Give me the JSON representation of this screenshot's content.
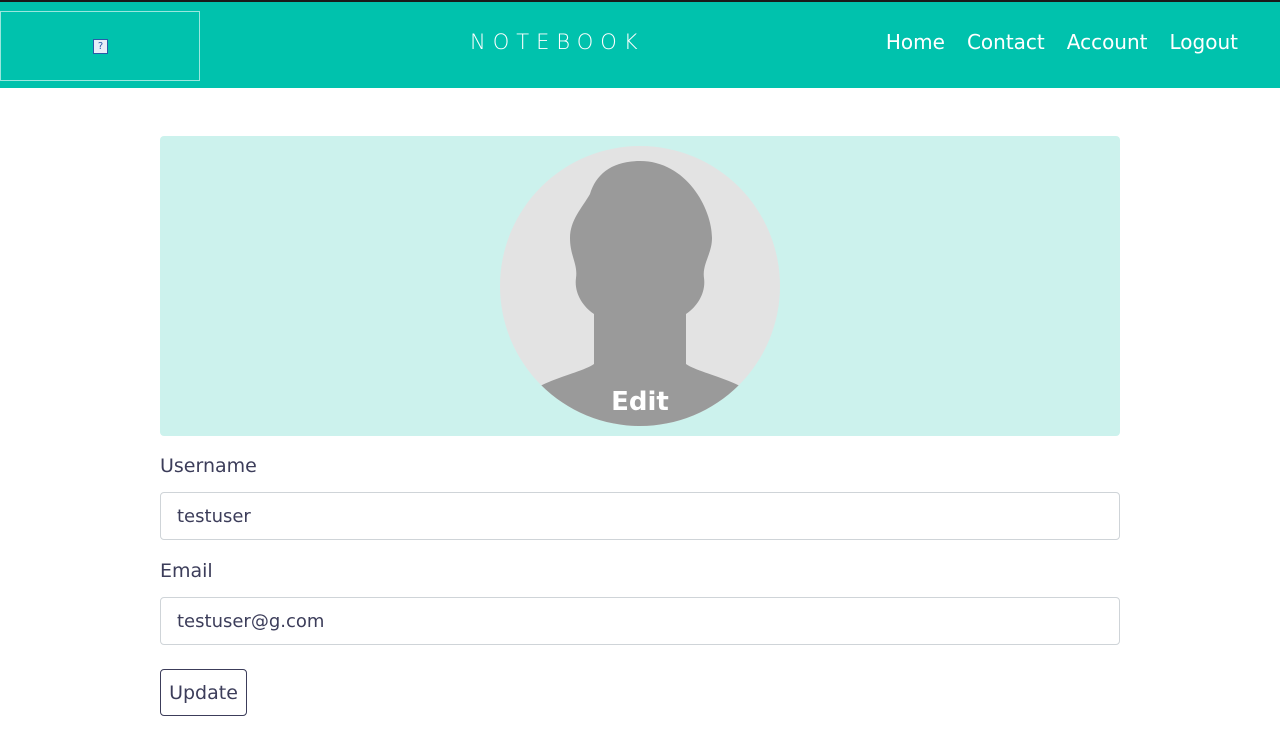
{
  "navbar": {
    "brand": "NOTEBOOK",
    "logo_icon": "?",
    "links": [
      "Home",
      "Contact",
      "Account",
      "Logout"
    ]
  },
  "profile": {
    "edit_label": "Edit"
  },
  "form": {
    "username_label": "Username",
    "username_value": "testuser",
    "email_label": "Email",
    "email_value": "testuser@g.com",
    "update_label": "Update"
  },
  "colors": {
    "navbar": "#00c2ad",
    "card": "#ccf2ed",
    "text": "#3c3d5a"
  }
}
